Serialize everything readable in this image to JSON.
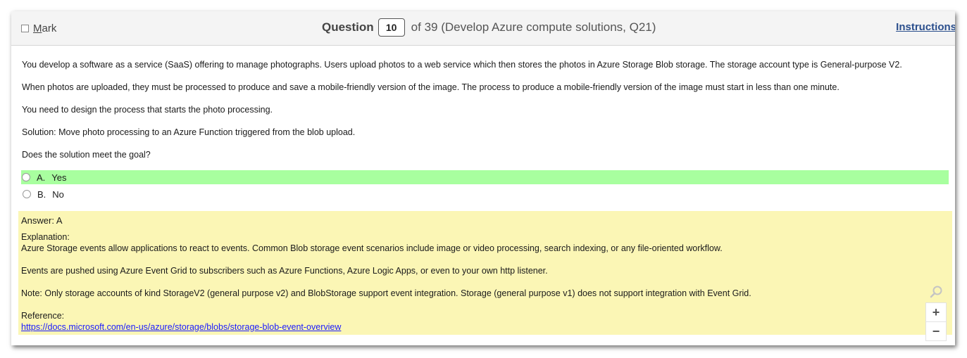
{
  "header": {
    "mark_label_first": "M",
    "mark_label_rest": "ark",
    "question_word": "Question",
    "question_number": "10",
    "question_of": "of 39 (Develop Azure compute solutions, Q21)",
    "instructions_label": "Instructions"
  },
  "question": {
    "paragraphs": [
      "You develop a software as a service (SaaS) offering to manage photographs. Users upload photos to a web service which then stores the photos in Azure Storage Blob storage. The storage account type is General-purpose V2.",
      "When photos are uploaded, they must be processed to produce and save a mobile-friendly version of the image. The process to produce a mobile-friendly version of the image must start in less than one minute.",
      "You need to design the process that starts the photo processing.",
      "Solution: Move photo processing to an Azure Function triggered from the blob upload.",
      "Does the solution meet the goal?"
    ],
    "options": [
      {
        "letter": "A.",
        "text": "Yes",
        "correct": true
      },
      {
        "letter": "B.",
        "text": "No",
        "correct": false
      }
    ]
  },
  "answer": {
    "answer_line": "Answer: A",
    "explanation_label": "Explanation:",
    "explanation": [
      "Azure Storage events allow applications to react to events. Common Blob storage event scenarios include image or video processing, search indexing, or any file-oriented workflow.",
      "Events are pushed using Azure Event Grid to subscribers such as Azure Functions, Azure Logic Apps, or even to your own http listener.",
      "Note: Only storage accounts of kind StorageV2 (general purpose v2) and BlobStorage support event integration. Storage (general purpose v1) does not support integration with Event Grid."
    ],
    "reference_label": "Reference:",
    "reference_link": "https://docs.microsoft.com/en-us/azure/storage/blobs/storage-blob-event-overview"
  },
  "zoom": {
    "search_icon": "magnifier-icon",
    "zoom_in_label": "+",
    "zoom_out_label": "−"
  },
  "colors": {
    "correct_option_bg": "#a8ff9f",
    "answer_box_bg": "#fbf6b5",
    "link": "#1a1aff",
    "instructions_link": "#2a4e8c"
  }
}
